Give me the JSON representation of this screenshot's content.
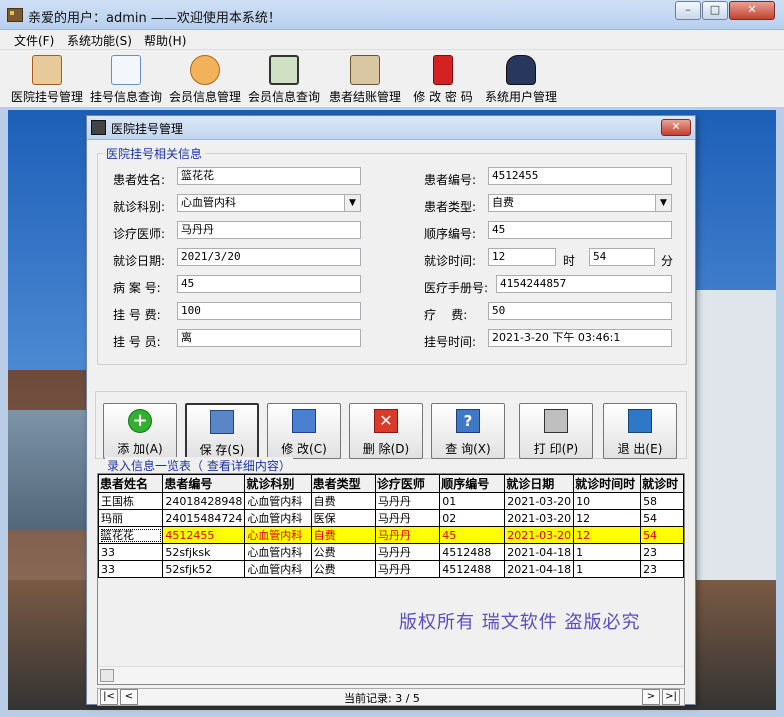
{
  "window": {
    "title": "亲爱的用户：admin ——欢迎使用本系统！",
    "minimize": "–",
    "maximize": "□",
    "close": "✕"
  },
  "menu": [
    {
      "label": "文件(F)"
    },
    {
      "label": "系统功能(S)"
    },
    {
      "label": "帮助(H)"
    }
  ],
  "toolbar": [
    {
      "label": "医院挂号管理",
      "icon": "scroll-icon",
      "color": "#c85a1e"
    },
    {
      "label": "挂号信息查询",
      "icon": "document-search-icon",
      "color": "#6a8fbf"
    },
    {
      "label": "会员信息管理",
      "icon": "users-icon",
      "color": "#d9782a"
    },
    {
      "label": "会员信息查询",
      "icon": "book-icon",
      "color": "#3d6b3b"
    },
    {
      "label": "患者结账管理",
      "icon": "cash-register-icon",
      "color": "#8a6a3a"
    },
    {
      "label": "修 改 密 码",
      "icon": "red-book-icon",
      "color": "#c81e1e"
    },
    {
      "label": "系统用户管理",
      "icon": "user-admin-icon",
      "color": "#2a3f70"
    }
  ],
  "dialog": {
    "title": "医院挂号管理",
    "close": "✕",
    "group_title": "医院挂号相关信息",
    "fields": {
      "patient_name": {
        "label": "患者姓名:",
        "value": "篮花花"
      },
      "patient_id": {
        "label": "患者编号:",
        "value": "4512455"
      },
      "department": {
        "label": "就诊科别:",
        "value": "心血管内科"
      },
      "patient_type": {
        "label": "患者类型:",
        "value": "自费"
      },
      "doctor": {
        "label": "诊疗医师:",
        "value": "马丹丹"
      },
      "sequence_no": {
        "label": "顺序编号:",
        "value": "45"
      },
      "visit_date": {
        "label": "就诊日期:",
        "value": "2021/3/20"
      },
      "visit_time": {
        "label": "就诊时间:",
        "hour": "12",
        "hour_unit": "时",
        "minute": "54",
        "minute_unit": "分"
      },
      "case_no": {
        "label": "病 案 号:",
        "value": "45"
      },
      "medical_book_no": {
        "label": "医疗手册号:",
        "value": "4154244857"
      },
      "reg_fee": {
        "label": "挂 号 费:",
        "value": "100"
      },
      "treatment_fee": {
        "label": "疗    费:",
        "value": "50"
      },
      "registrar": {
        "label": "挂 号 员:",
        "value": "离"
      },
      "reg_time": {
        "label": "挂号时间:",
        "value": "2021-3-20 下午 03:46:1"
      }
    },
    "buttons": [
      {
        "label": "添 加(A)",
        "icon": "plus-icon"
      },
      {
        "label": "保 存(S)",
        "icon": "floppy-icon"
      },
      {
        "label": "修 改(C)",
        "icon": "edit-icon"
      },
      {
        "label": "删 除(D)",
        "icon": "delete-icon"
      },
      {
        "label": "查 询(X)",
        "icon": "query-icon"
      },
      {
        "label": "打 印(P)",
        "icon": "printer-icon"
      },
      {
        "label": "退 出(E)",
        "icon": "exit-icon"
      }
    ],
    "grid_title": "录入信息一览表（     查看详细内容）",
    "grid": {
      "columns": [
        "患者姓名",
        "患者编号",
        "就诊科别",
        "患者类型",
        "诊疗医师",
        "顺序编号",
        "就诊日期",
        "就诊时间时",
        "就诊时"
      ],
      "rows": [
        [
          "王国栋",
          "24018428948",
          "心血管内科",
          "自费",
          "马丹丹",
          "01",
          "2021-03-20",
          "10",
          "58"
        ],
        [
          "玛丽",
          "24015484724",
          "心血管内科",
          "医保",
          "马丹丹",
          "02",
          "2021-03-20",
          "12",
          "54"
        ],
        [
          "篮花花",
          "4512455",
          "心血管内科",
          "自费",
          "马丹丹",
          "45",
          "2021-03-20",
          "12",
          "54"
        ],
        [
          "33",
          "52sfjksk",
          "心血管内科",
          "公费",
          "马丹丹",
          "4512488",
          "2021-04-18",
          "1",
          "23"
        ],
        [
          "33",
          "52sfjk52",
          "心血管内科",
          "公费",
          "马丹丹",
          "4512488",
          "2021-04-18",
          "1",
          "23"
        ]
      ],
      "selected_row": 2
    },
    "copyright": "版权所有  瑞文软件  盗版必究",
    "navigator": {
      "first": "|<",
      "prev": "<",
      "next": ">",
      "last": ">|",
      "record_text": "当前记录: 3 / 5"
    }
  }
}
